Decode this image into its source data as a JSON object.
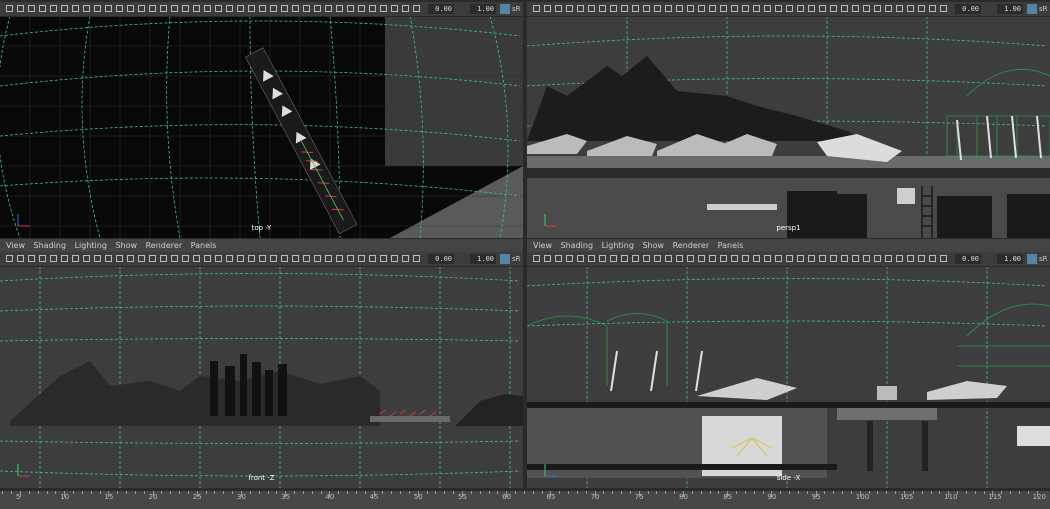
{
  "panel_menu": [
    "View",
    "Shading",
    "Lighting",
    "Show",
    "Renderer",
    "Panels"
  ],
  "toolbar": {
    "field_a": "0.00",
    "field_b": "1.00",
    "srgb": "sR"
  },
  "viewports": [
    {
      "id": "top",
      "camera": "top -Y"
    },
    {
      "id": "persp",
      "camera": "persp1"
    },
    {
      "id": "front",
      "camera": "front -Z"
    },
    {
      "id": "side",
      "camera": "side -X"
    }
  ],
  "timeline": {
    "labels": [
      "5",
      "10",
      "15",
      "20",
      "25",
      "30",
      "35",
      "40",
      "45",
      "50",
      "55",
      "60",
      "65",
      "70",
      "75",
      "80",
      "85",
      "90",
      "95",
      "100",
      "105",
      "110",
      "115",
      "120"
    ]
  },
  "colors": {
    "grid": "#3fbf9a",
    "wire": "#2b9a4a",
    "axis_x": "#d23b3b",
    "axis_y": "#3bd26a",
    "axis_z": "#3b6ad2",
    "accent": "#5285a6"
  }
}
